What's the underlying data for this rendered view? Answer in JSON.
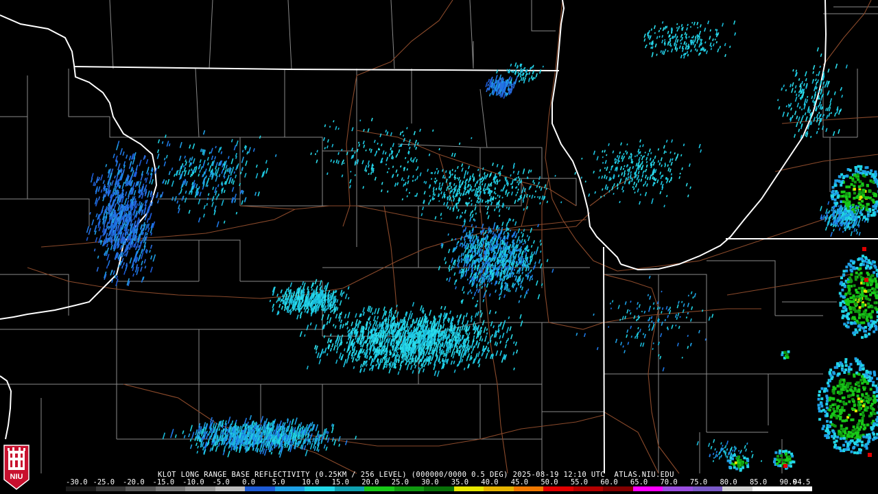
{
  "product": {
    "title": "KLOT LONG RANGE BASE REFLECTIVITY (0.25KM / 256 LEVEL) (000000/0000 0.5 DEG)",
    "timestamp": "2025-08-19 12:10 UTC",
    "source": "ATLAS.NIU.EDU"
  },
  "scale": {
    "ticks": [
      "-30.0",
      "-25.0",
      "-20.0",
      "-15.0",
      "-10.0",
      "-5.0",
      "0.0",
      "5.0",
      "10.0",
      "15.0",
      "20.0",
      "25.0",
      "30.0",
      "35.0",
      "40.0",
      "45.0",
      "50.0",
      "55.0",
      "60.0",
      "65.0",
      "70.0",
      "75.0",
      "80.0",
      "85.0",
      "90.0",
      "94.5"
    ],
    "colors": [
      "#1a1a1a",
      "#3a3a3a",
      "#5a5a5a",
      "#7a7a7a",
      "#9a9a9a",
      "#bdbdbd",
      "#1e5bd6",
      "#1ea0e6",
      "#21d6e6",
      "#0fa0b0",
      "#18c818",
      "#109810",
      "#087008",
      "#e6e600",
      "#e6b400",
      "#f07800",
      "#e00000",
      "#b40000",
      "#820000",
      "#ff00ff",
      "#9a4ee0",
      "#7a5ac8",
      "#d2d2d2",
      "#ffffff",
      "#ffffff"
    ]
  },
  "logo": {
    "text": "NIU",
    "color": "#c8102e"
  },
  "colors": {
    "background": "#000000",
    "state_border": "#ffffff",
    "county_line": "#8a8a8a",
    "highway": "#8b4a2b"
  }
}
